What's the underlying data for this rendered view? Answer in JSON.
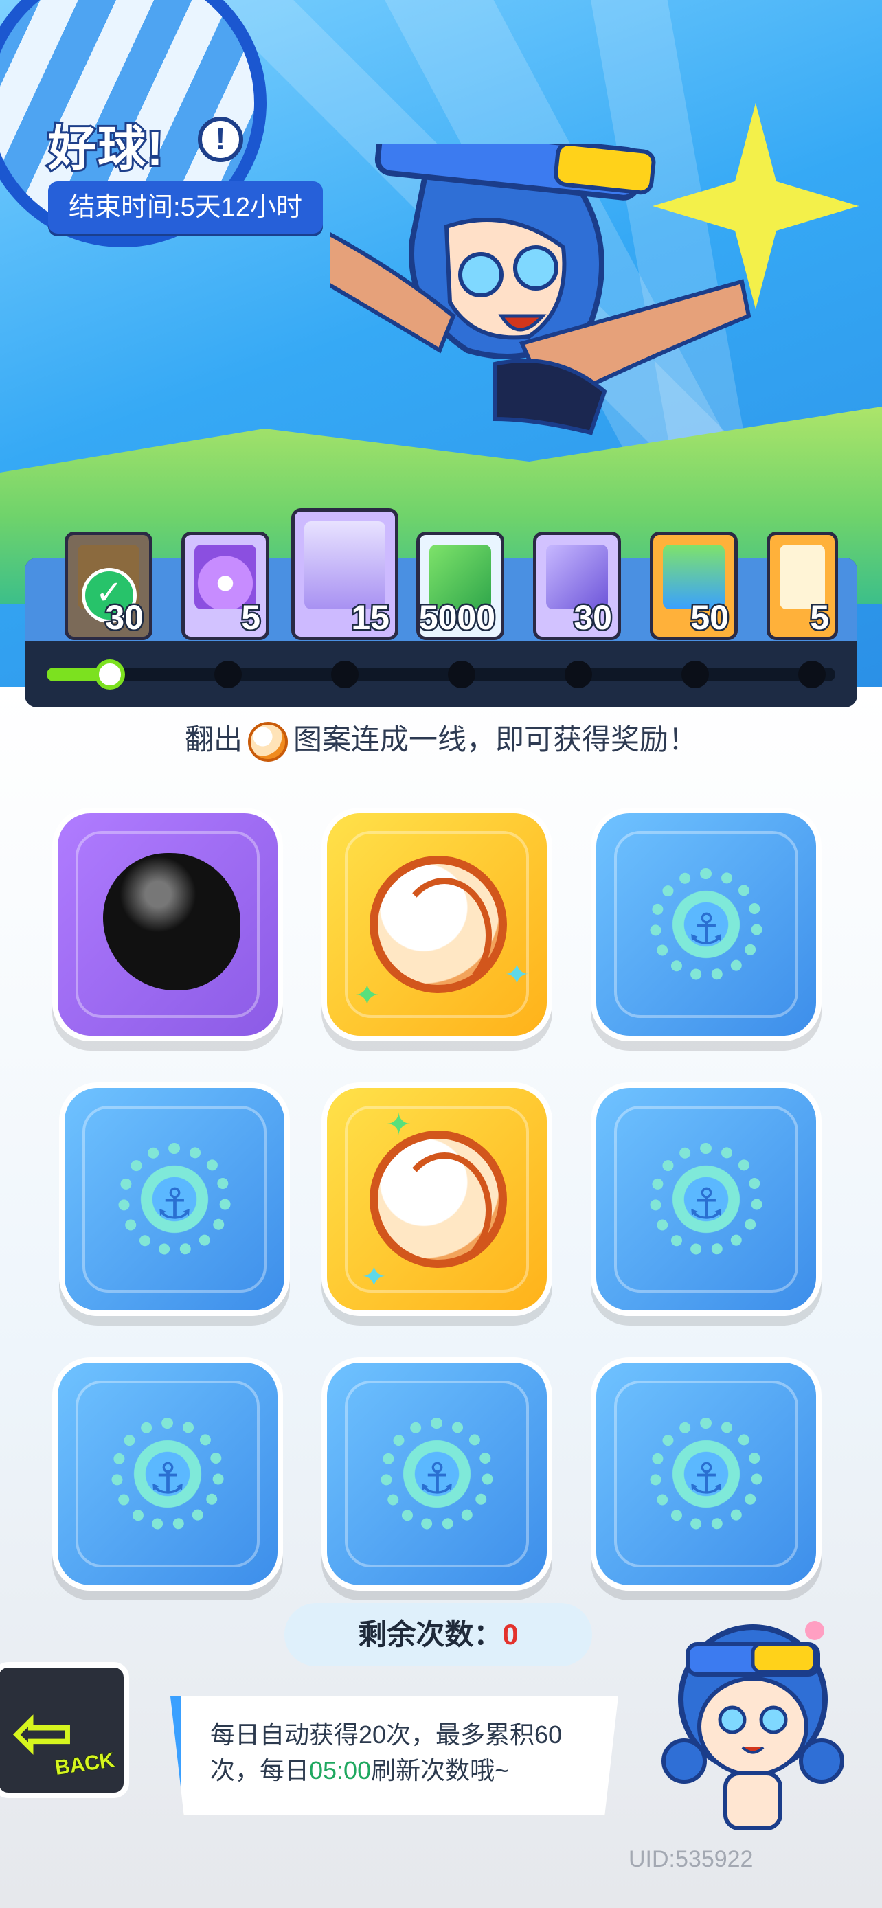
{
  "event": {
    "title": "好球!",
    "info_icon": "exclamation-icon",
    "end_time": "结束时间:5天12小时"
  },
  "rewards": [
    {
      "icon": "jar-icon",
      "qty": "30",
      "claimed": true
    },
    {
      "icon": "purple-flame-icon",
      "qty": "5",
      "claimed": false
    },
    {
      "icon": "cool-can-icon",
      "qty": "15",
      "claimed": false
    },
    {
      "icon": "cash-icon",
      "qty": "5000",
      "claimed": false
    },
    {
      "icon": "card-pack-icon",
      "qty": "30",
      "claimed": false
    },
    {
      "icon": "orange-jar-icon",
      "qty": "50",
      "claimed": false
    },
    {
      "icon": "sticker-icon",
      "qty": "5",
      "claimed": false
    }
  ],
  "progress": {
    "current": 1,
    "total": 7
  },
  "instruction": {
    "before": "翻出",
    "icon": "volleyball-icon",
    "after": "图案连成一线，即可获得奖励！"
  },
  "grid": [
    [
      "ink-blob",
      "volleyball",
      "anchor-wheel"
    ],
    [
      "anchor-wheel",
      "volleyball",
      "anchor-wheel"
    ],
    [
      "anchor-wheel",
      "anchor-wheel",
      "anchor-wheel"
    ]
  ],
  "remaining": {
    "label": "剩余次数：",
    "count": "0"
  },
  "back": {
    "label": "BACK"
  },
  "tip": {
    "before": "每日自动获得20次，最多累积60次，每日",
    "time": "05:00",
    "after": "刷新次数哦~"
  },
  "uid": "UID:535922",
  "colors": {
    "accent": "#2660d9",
    "progress": "#7ce11f",
    "remaining": "#e3322c",
    "time": "#1fa860"
  }
}
